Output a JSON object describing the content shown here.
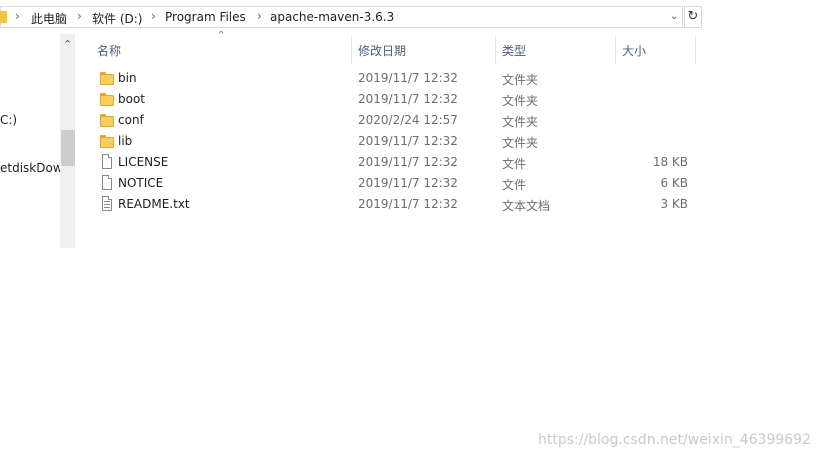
{
  "breadcrumb": {
    "items": [
      "此电脑",
      "软件 (D:)",
      "Program Files",
      "apache-maven-3.6.3"
    ],
    "separator": "›"
  },
  "nav": {
    "items": [
      "C:)",
      "etdiskDown"
    ]
  },
  "columns": {
    "name": "名称",
    "date": "修改日期",
    "type": "类型",
    "size": "大小"
  },
  "files": [
    {
      "name": "bin",
      "date": "2019/11/7 12:32",
      "type": "文件夹",
      "size": "",
      "icon": "folder-icon"
    },
    {
      "name": "boot",
      "date": "2019/11/7 12:32",
      "type": "文件夹",
      "size": "",
      "icon": "folder-icon"
    },
    {
      "name": "conf",
      "date": "2020/2/24 12:57",
      "type": "文件夹",
      "size": "",
      "icon": "folder-icon"
    },
    {
      "name": "lib",
      "date": "2019/11/7 12:32",
      "type": "文件夹",
      "size": "",
      "icon": "folder-icon"
    },
    {
      "name": "LICENSE",
      "date": "2019/11/7 12:32",
      "type": "文件",
      "size": "18 KB",
      "icon": "file-icon"
    },
    {
      "name": "NOTICE",
      "date": "2019/11/7 12:32",
      "type": "文件",
      "size": "6 KB",
      "icon": "file-icon"
    },
    {
      "name": "README.txt",
      "date": "2019/11/7 12:32",
      "type": "文本文档",
      "size": "3 KB",
      "icon": "text-file-icon"
    }
  ],
  "watermark": "https://blog.csdn.net/weixin_46399692",
  "colors": {
    "folder": "#f8cf5a",
    "header_text": "#4c607a",
    "border": "#d9d9d9"
  }
}
